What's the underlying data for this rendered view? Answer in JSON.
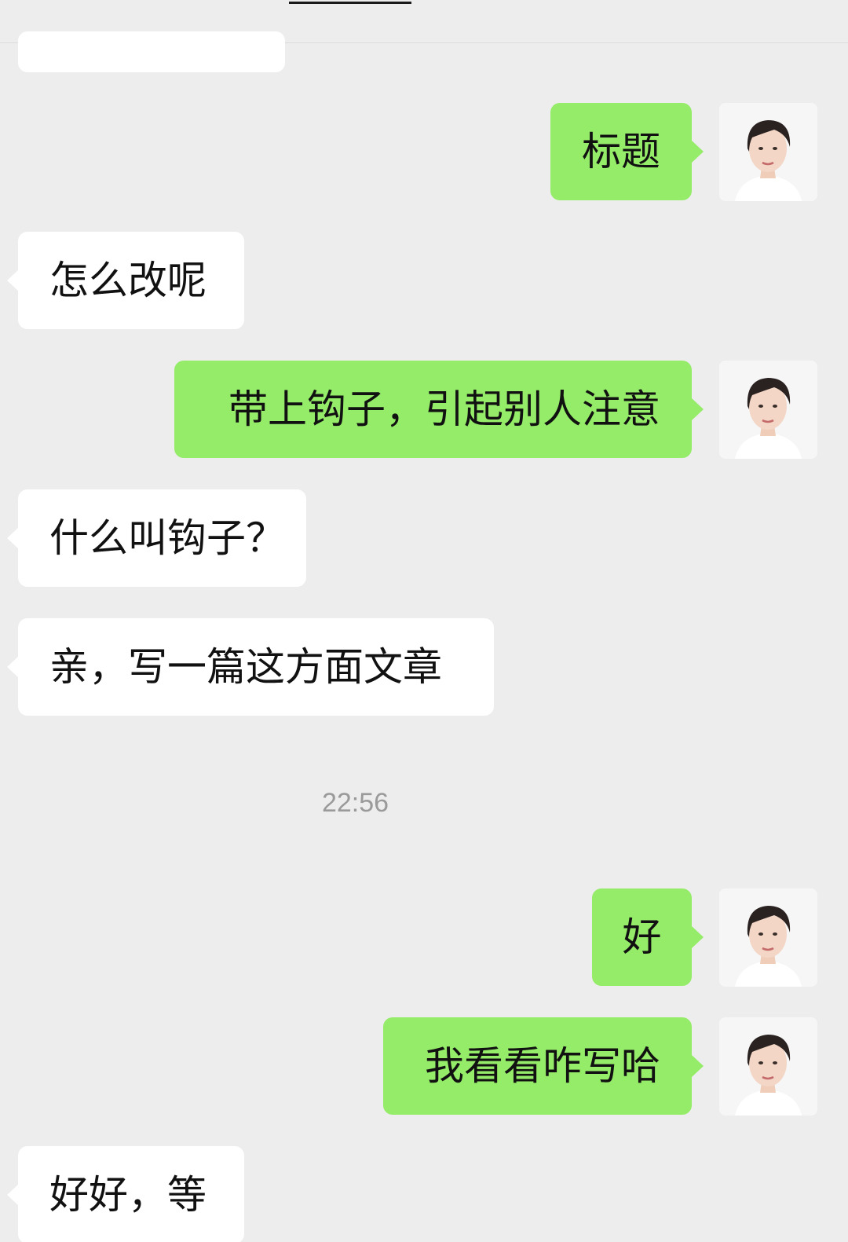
{
  "chat": {
    "timestamp": "22:56",
    "messages": [
      {
        "id": "m0",
        "side": "left",
        "text": ""
      },
      {
        "id": "m1",
        "side": "right",
        "text": "标题"
      },
      {
        "id": "m2",
        "side": "left",
        "text": "怎么改呢"
      },
      {
        "id": "m3",
        "side": "right",
        "text": "带上钩子，引起别人注意"
      },
      {
        "id": "m4",
        "side": "left",
        "text": "什么叫钩子？"
      },
      {
        "id": "m5",
        "side": "left",
        "text": "亲，写一篇这方面文章"
      },
      {
        "id": "m6",
        "side": "right",
        "text": "好"
      },
      {
        "id": "m7",
        "side": "right",
        "text": "我看看咋写哈"
      },
      {
        "id": "m8",
        "side": "left",
        "text": "好好，等"
      }
    ]
  },
  "colors": {
    "background": "#ededed",
    "bubble_sent": "#95ec69",
    "bubble_received": "#ffffff",
    "text": "#111111",
    "timestamp": "#9a9a9a"
  },
  "icons": {
    "avatar": "user-avatar-portrait-icon"
  }
}
